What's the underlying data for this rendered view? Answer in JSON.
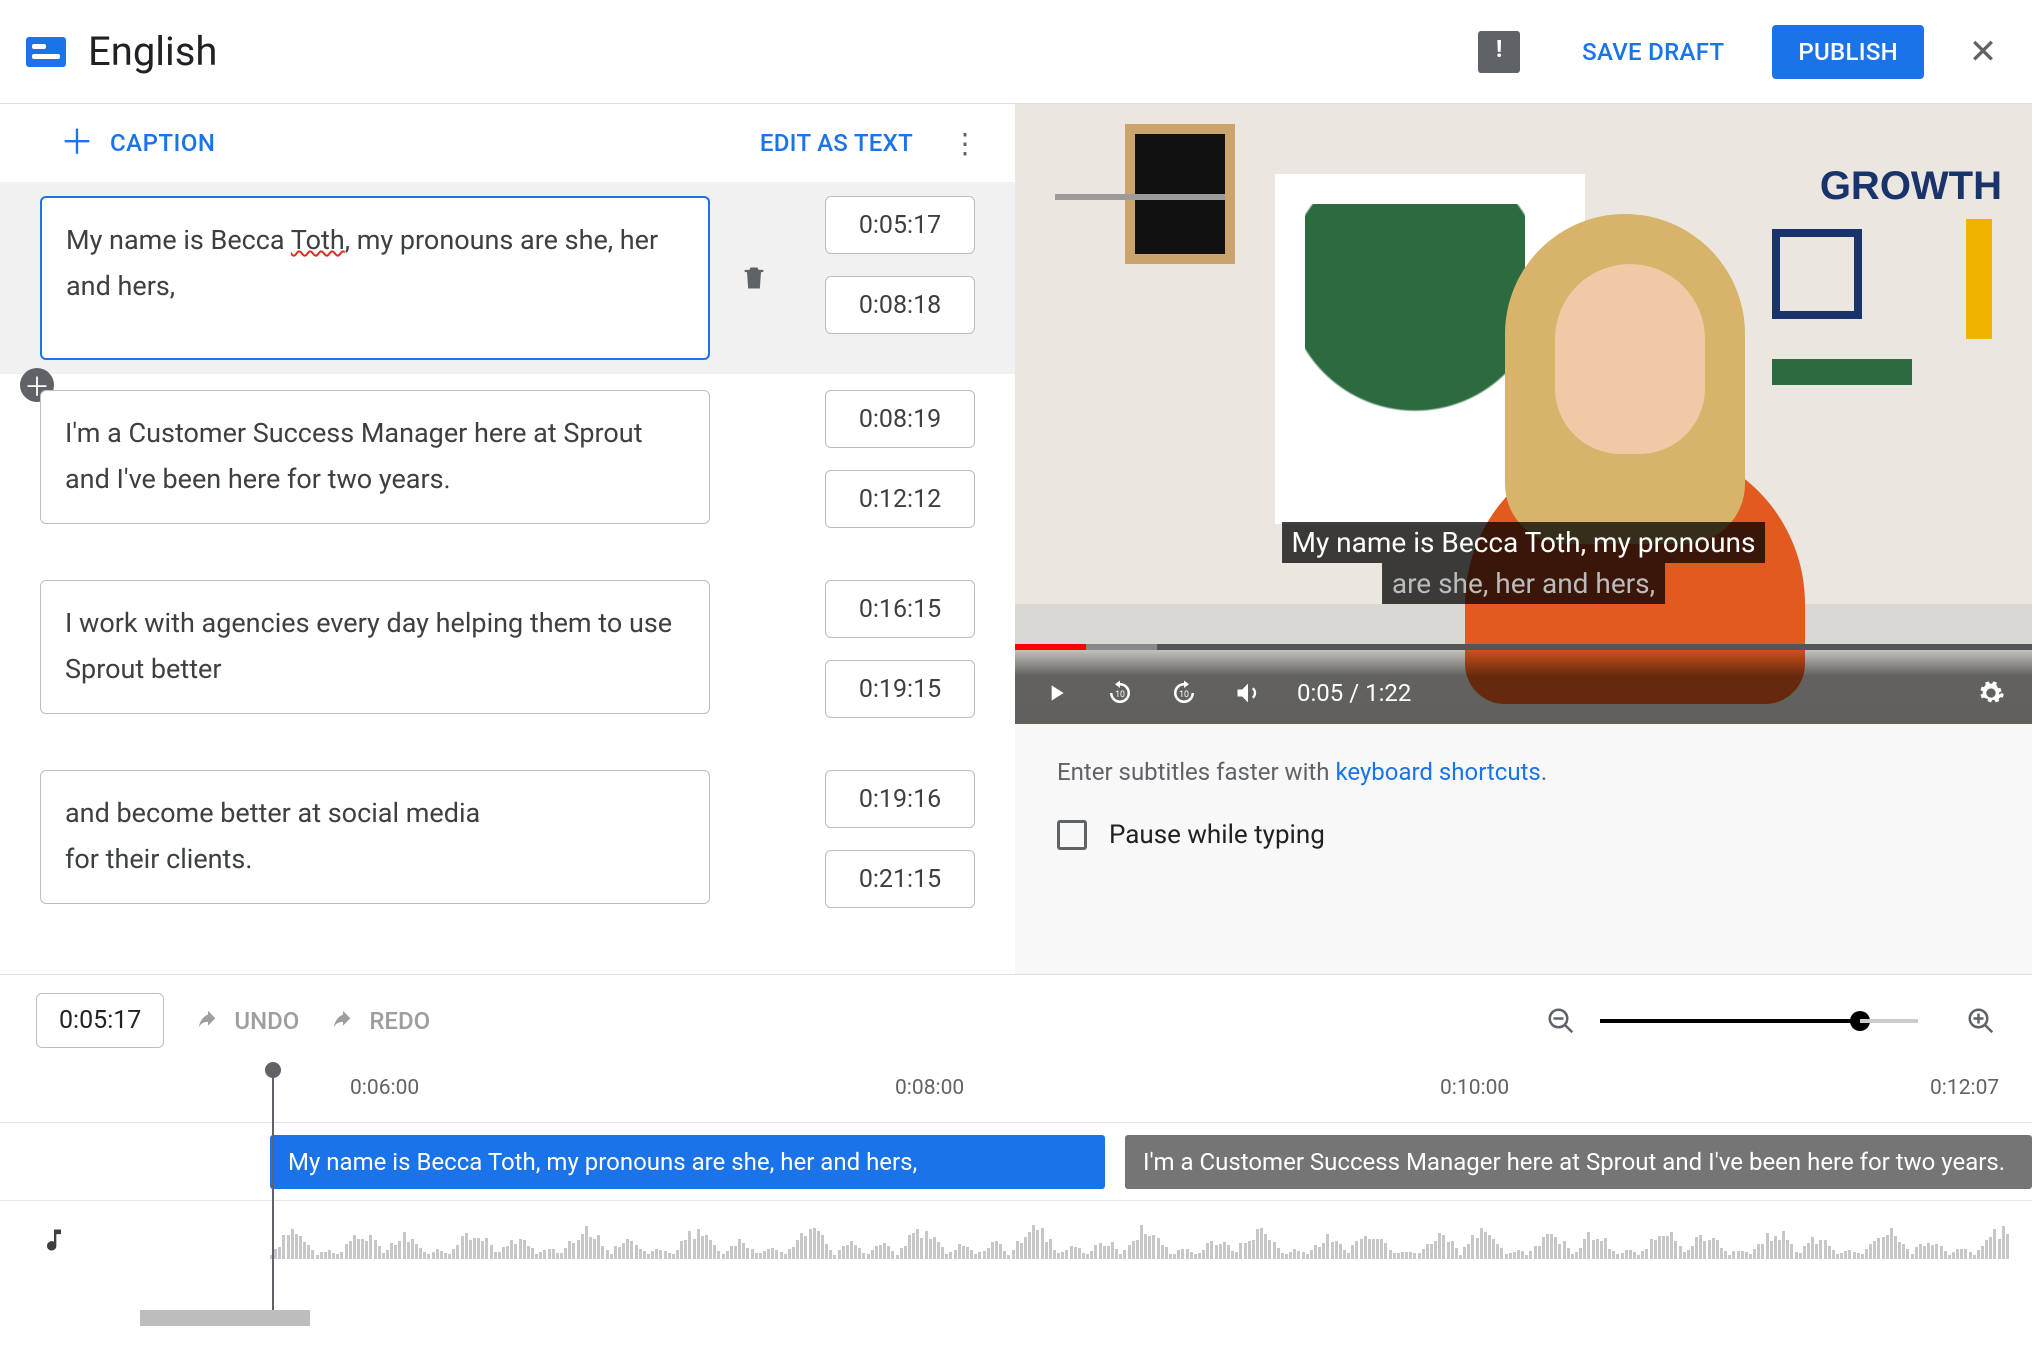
{
  "header": {
    "title": "English",
    "save_label": "SAVE DRAFT",
    "publish_label": "PUBLISH"
  },
  "left_toolbar": {
    "caption_label": "CAPTION",
    "edit_as_text_label": "EDIT AS TEXT"
  },
  "captions": [
    {
      "text_pre": "My name is Becca ",
      "text_spell": "Toth",
      "text_post": ", my pronouns are she, her and hers,",
      "start": "0:05:17",
      "end": "0:08:18",
      "selected": true
    },
    {
      "text": "I'm a Customer Success Manager here at Sprout\nand I've been here for two years.",
      "start": "0:08:19",
      "end": "0:12:12"
    },
    {
      "text": "I work with agencies every day helping them to use Sprout better",
      "start": "0:16:15",
      "end": "0:19:15"
    },
    {
      "text": "and become better at social media\nfor their clients.",
      "start": "0:19:16",
      "end": "0:21:15"
    }
  ],
  "video": {
    "overlay_line1": "My name is Becca Toth, my pronouns",
    "overlay_line2": "are she, her and hers,",
    "time_label": "0:05 / 1:22",
    "wall_text": "GROWTH"
  },
  "hint": {
    "prefix": "Enter subtitles faster with ",
    "link": "keyboard shortcuts",
    "suffix": "."
  },
  "pause_checkbox_label": "Pause while typing",
  "bottom": {
    "position": "0:05:17",
    "undo_label": "UNDO",
    "redo_label": "REDO"
  },
  "timeline": {
    "ticks": [
      "0:06:00",
      "0:08:00",
      "0:10:00",
      "0:12:07"
    ],
    "seg1": "My name is Becca Toth, my pronouns are she, her and hers,",
    "seg2": "I'm a Customer Success Manager here at Sprout and I've been here for two years."
  }
}
